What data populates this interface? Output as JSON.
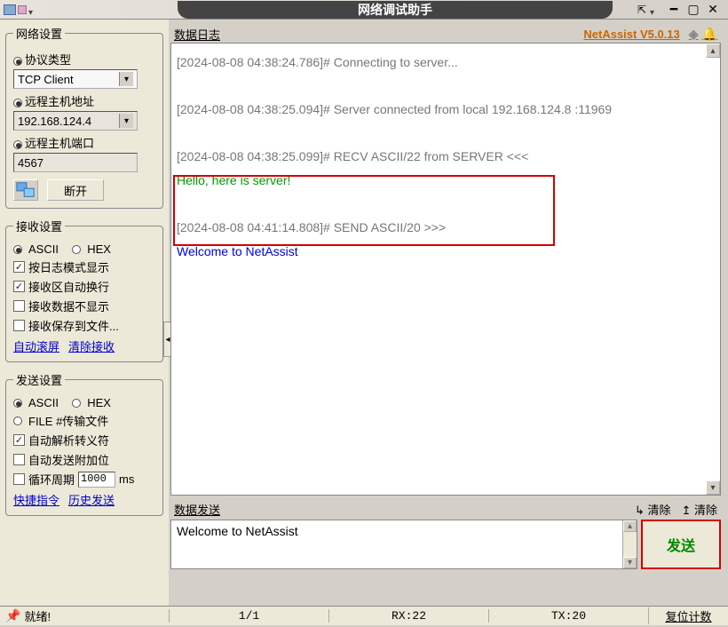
{
  "window": {
    "title": "网络调试助手"
  },
  "version": "NetAssist V5.0.13",
  "sidebar": {
    "net_settings": {
      "legend": "网络设置",
      "protocol_label": "协议类型",
      "protocol_value": "TCP Client",
      "host_label": "远程主机地址",
      "host_value": "192.168.124.4",
      "port_label": "远程主机端口",
      "port_value": "4567",
      "disconnect_btn": "断开"
    },
    "recv_settings": {
      "legend": "接收设置",
      "ascii": "ASCII",
      "hex": "HEX",
      "log_mode": "按日志模式显示",
      "auto_wrap": "接收区自动换行",
      "hide_recv": "接收数据不显示",
      "save_to_file": "接收保存到文件...",
      "auto_scroll": "自动滚屏",
      "clear_recv": "清除接收"
    },
    "send_settings": {
      "legend": "发送设置",
      "ascii": "ASCII",
      "hex": "HEX",
      "file_transfer": "FILE #传输文件",
      "auto_escape": "自动解析转义符",
      "auto_append": "自动发送附加位",
      "cycle_send": "循环周期",
      "cycle_value": "1000",
      "cycle_unit": "ms",
      "quick_cmd": "快捷指令",
      "history": "历史发送"
    }
  },
  "log": {
    "title": "数据日志",
    "lines": [
      {
        "t": "[2024-08-08 04:38:24.786]# Connecting to server...",
        "cls": "meta"
      },
      {
        "t": "",
        "cls": "meta"
      },
      {
        "t": "[2024-08-08 04:38:25.094]# Server connected from local 192.168.124.8 :11969",
        "cls": "meta"
      },
      {
        "t": "",
        "cls": "meta"
      },
      {
        "t": "[2024-08-08 04:38:25.099]# RECV ASCII/22 from SERVER <<<",
        "cls": "meta"
      },
      {
        "t": "Hello, here is server!",
        "cls": "recv-data"
      },
      {
        "t": "",
        "cls": "meta"
      },
      {
        "t": "[2024-08-08 04:41:14.808]# SEND ASCII/20 >>>",
        "cls": "meta"
      },
      {
        "t": "Welcome to NetAssist",
        "cls": "send-data"
      }
    ]
  },
  "send": {
    "title": "数据发送",
    "clear_input": "清除",
    "clear_output": "清除",
    "content": "Welcome to NetAssist",
    "send_btn": "发送"
  },
  "status": {
    "ready": "就绪!",
    "page": "1/1",
    "rx": "RX:22",
    "tx": "TX:20",
    "reset": "复位计数"
  }
}
